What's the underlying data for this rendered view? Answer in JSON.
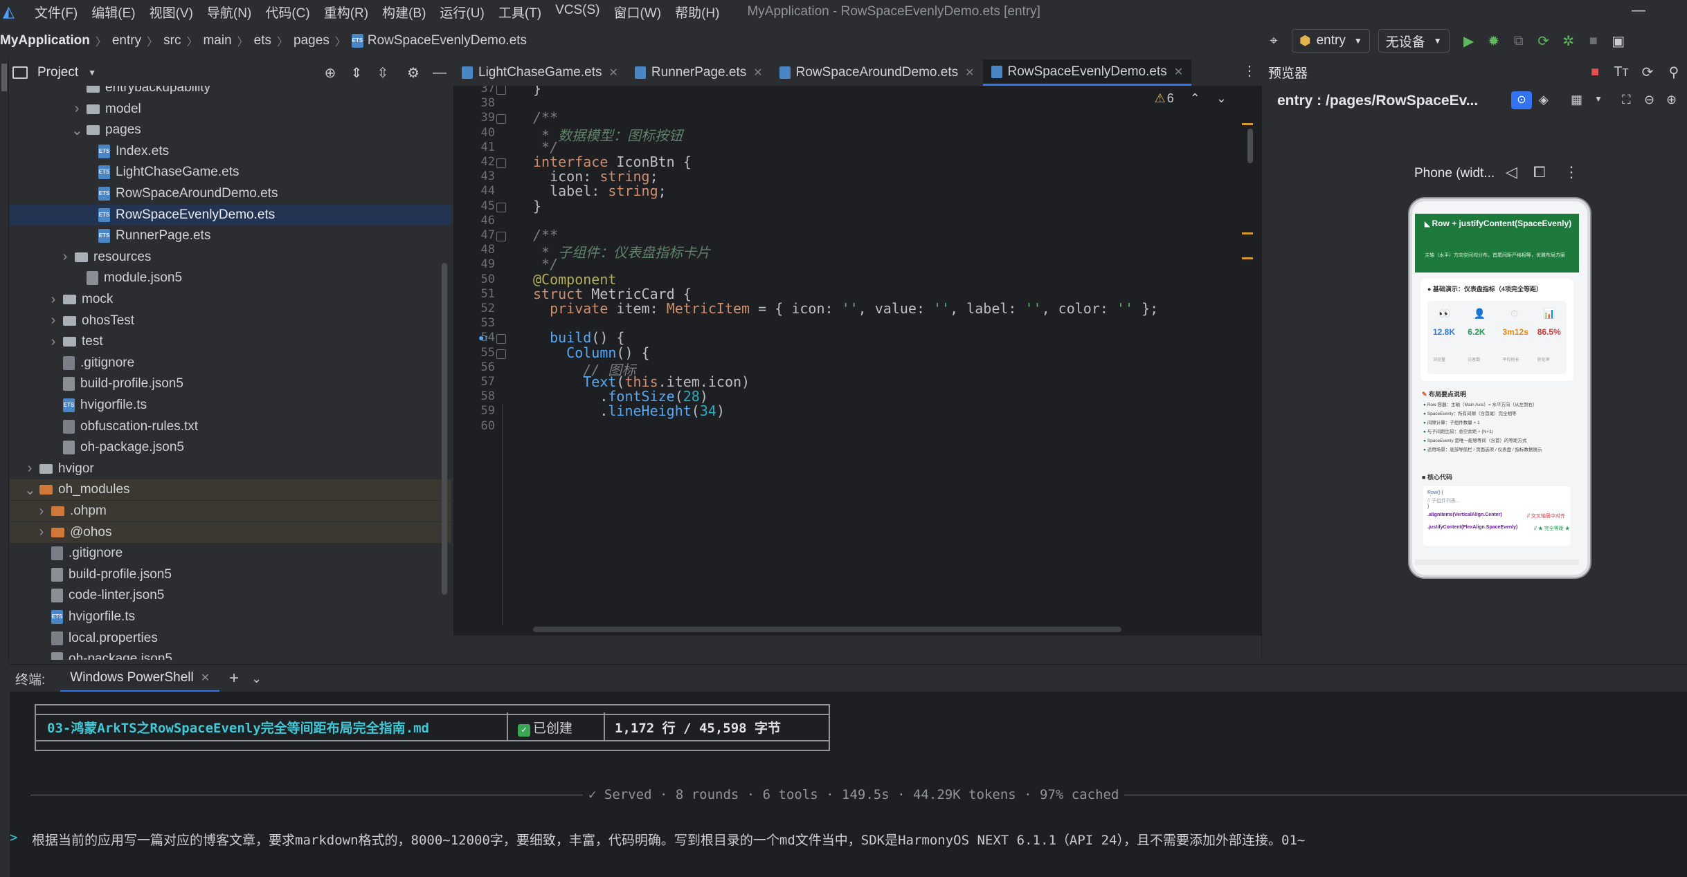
{
  "menubar": {
    "items": [
      "文件(F)",
      "编辑(E)",
      "视图(V)",
      "导航(N)",
      "代码(C)",
      "重构(R)",
      "构建(B)",
      "运行(U)",
      "工具(T)",
      "VCS(S)",
      "窗口(W)",
      "帮助(H)"
    ],
    "window_title": "MyApplication - RowSpaceEvenlyDemo.ets [entry]"
  },
  "breadcrumb": {
    "items": [
      "MyApplication",
      "entry",
      "src",
      "main",
      "ets",
      "pages",
      "RowSpaceEvenlyDemo.ets"
    ]
  },
  "toolbar": {
    "config": "entry",
    "device": "无设备"
  },
  "project": {
    "title": "Project",
    "tree": [
      {
        "label": "entrybackupability",
        "kind": "folder",
        "depth": 5,
        "chev": ""
      },
      {
        "label": "model",
        "kind": "folder",
        "depth": 5,
        "chev": "›"
      },
      {
        "label": "pages",
        "kind": "folder",
        "depth": 5,
        "chev": "⌄"
      },
      {
        "label": "Index.ets",
        "kind": "ets",
        "depth": 6,
        "chev": ""
      },
      {
        "label": "LightChaseGame.ets",
        "kind": "ets",
        "depth": 6,
        "chev": ""
      },
      {
        "label": "RowSpaceAroundDemo.ets",
        "kind": "ets",
        "depth": 6,
        "chev": ""
      },
      {
        "label": "RowSpaceEvenlyDemo.ets",
        "kind": "ets",
        "depth": 6,
        "chev": "",
        "selected": true
      },
      {
        "label": "RunnerPage.ets",
        "kind": "ets",
        "depth": 6,
        "chev": ""
      },
      {
        "label": "resources",
        "kind": "folder",
        "depth": 4,
        "chev": "›"
      },
      {
        "label": "module.json5",
        "kind": "json",
        "depth": 5,
        "chev": ""
      },
      {
        "label": "mock",
        "kind": "folder",
        "depth": 3,
        "chev": "›"
      },
      {
        "label": "ohosTest",
        "kind": "folder",
        "depth": 3,
        "chev": "›"
      },
      {
        "label": "test",
        "kind": "folder",
        "depth": 3,
        "chev": "›"
      },
      {
        "label": ".gitignore",
        "kind": "txt",
        "depth": 3,
        "chev": ""
      },
      {
        "label": "build-profile.json5",
        "kind": "json",
        "depth": 3,
        "chev": ""
      },
      {
        "label": "hvigorfile.ts",
        "kind": "ets",
        "depth": 3,
        "chev": ""
      },
      {
        "label": "obfuscation-rules.txt",
        "kind": "txt",
        "depth": 3,
        "chev": ""
      },
      {
        "label": "oh-package.json5",
        "kind": "json",
        "depth": 3,
        "chev": ""
      },
      {
        "label": "hvigor",
        "kind": "folder",
        "depth": 1,
        "chev": "›"
      },
      {
        "label": "oh_modules",
        "kind": "folder-orange",
        "depth": 1,
        "chev": "⌄",
        "module": true
      },
      {
        "label": ".ohpm",
        "kind": "folder-orange",
        "depth": 2,
        "chev": "›",
        "module": true
      },
      {
        "label": "@ohos",
        "kind": "folder-orange",
        "depth": 2,
        "chev": "›",
        "module": true
      },
      {
        "label": ".gitignore",
        "kind": "txt",
        "depth": 2,
        "chev": ""
      },
      {
        "label": "build-profile.json5",
        "kind": "json",
        "depth": 2,
        "chev": ""
      },
      {
        "label": "code-linter.json5",
        "kind": "json",
        "depth": 2,
        "chev": ""
      },
      {
        "label": "hvigorfile.ts",
        "kind": "ets",
        "depth": 2,
        "chev": ""
      },
      {
        "label": "local.properties",
        "kind": "txt",
        "depth": 2,
        "chev": ""
      },
      {
        "label": "oh-package.json5",
        "kind": "json",
        "depth": 2,
        "chev": ""
      }
    ]
  },
  "tabs": [
    {
      "label": "LightChaseGame.ets",
      "active": false
    },
    {
      "label": "RunnerPage.ets",
      "active": false
    },
    {
      "label": "RowSpaceAroundDemo.ets",
      "active": false
    },
    {
      "label": "RowSpaceEvenlyDemo.ets",
      "active": true
    }
  ],
  "editor": {
    "warning_count": "6",
    "lines": [
      {
        "n": "37",
        "html": "}"
      },
      {
        "n": "38",
        "html": ""
      },
      {
        "n": "39",
        "html": "<span class='cm'>/**</span>"
      },
      {
        "n": "40",
        "html": "<span class='cm'> * </span><span class='cmz'>数据模型：图标按钮</span>"
      },
      {
        "n": "41",
        "html": "<span class='cm'> */</span>"
      },
      {
        "n": "42",
        "html": "<span class='kw'>interface</span> IconBtn {"
      },
      {
        "n": "43",
        "html": "  icon: <span class='ty'>string</span>;"
      },
      {
        "n": "44",
        "html": "  label: <span class='ty'>string</span>;"
      },
      {
        "n": "45",
        "html": "}"
      },
      {
        "n": "46",
        "html": ""
      },
      {
        "n": "47",
        "html": "<span class='cm'>/**</span>"
      },
      {
        "n": "48",
        "html": "<span class='cm'> * </span><span class='cmz'>子组件：仪表盘指标卡片</span>"
      },
      {
        "n": "49",
        "html": "<span class='cm'> */</span>"
      },
      {
        "n": "50",
        "html": "<span class='an'>@Component</span>"
      },
      {
        "n": "51",
        "html": "<span class='kw'>struct</span> <span class='fn' style='color:#bcbec4'>MetricCard</span> {"
      },
      {
        "n": "52",
        "html": "  <span class='kw'>private</span> item: <span class='ty'>MetricItem</span> = { icon: <span class='str'>''</span>, value: <span class='str'>''</span>, label: <span class='str'>''</span>, color: <span class='str'>''</span> };"
      },
      {
        "n": "53",
        "html": ""
      },
      {
        "n": "54",
        "html": "  <span class='fn'>build</span>() {"
      },
      {
        "n": "55",
        "html": "    <span class='fn'>Column</span>() {"
      },
      {
        "n": "56",
        "html": "      <span class='cm'>// 图标</span>"
      },
      {
        "n": "57",
        "html": "      <span class='fn'>Text</span>(<span class='kw'>this</span>.item.icon)"
      },
      {
        "n": "58",
        "html": "        .<span class='fn'>fontSize</span>(<span class='num'>28</span>)"
      },
      {
        "n": "59",
        "html": "        .<span class='fn'>lineHeight</span>(<span class='num'>34</span>)"
      },
      {
        "n": "60",
        "html": ""
      }
    ]
  },
  "preview": {
    "title": "预览器",
    "route": "entry : /pages/RowSpaceEv...",
    "device_label": "Phone (widt...",
    "phone": {
      "header_title": "Row + justifyContent(SpaceEvenly)",
      "header_sub": "主轴（水平）方向空间均分布，首尾间距严格相等，优雅布局方案",
      "section1": "● 基础演示：仪表盘指标（4项完全等距）",
      "metrics": [
        {
          "icon": "👀",
          "value": "12.8K",
          "label": "浏览量",
          "color": "#2b7bd8"
        },
        {
          "icon": "👤",
          "value": "6.2K",
          "label": "访客数",
          "color": "#1e9e53"
        },
        {
          "icon": "⏱",
          "value": "3m12s",
          "label": "平均时长",
          "color": "#e08a16"
        },
        {
          "icon": "📊",
          "value": "86.5%",
          "label": "转化率",
          "color": "#d33a3a"
        }
      ],
      "section2": "布局要点说明",
      "bullets": [
        "Row 容器：主轴（Main Axis）= 水平方向（从左到右）",
        "SpaceEvenly：所有间隙（含首尾）完全相等",
        "间隙计算：子组件数量 + 1",
        "与子间距比较：总空余距 ÷ (N+1)",
        "SpaceEvenly 是唯一能够等间（含首）的等距方式",
        "适用场景：底部导航栏 / 页面选项 / 仪表盘 / 指标数据展示"
      ],
      "section3": "核心代码",
      "code": [
        "Row() {",
        "  // 子组件列表...",
        "}",
        ".alignItems(VerticalAlign.Center)",
        ".justifyContent(FlexAlign.SpaceEvenly)"
      ],
      "code_comments": [
        "// 交叉轴居中对齐",
        "// ★ 完全等距 ★"
      ]
    }
  },
  "terminal": {
    "label": "终端:",
    "tab": "Windows PowerShell",
    "table": {
      "file": "03-鸿蒙ArkTS之RowSpaceEvenly完全等间距布局完全指南.md",
      "status": "已创建",
      "stats": "1,172 行 / 45,598 字节"
    },
    "served": "✓ Served · 8 rounds · 6 tools · 149.5s · 44.29K tokens · 97% cached",
    "prompt": "根据当前的应用写一篇对应的博客文章，要求markdown格式的，8000~12000字，要细致，丰富，代码明确。写到根目录的一个md文件当中，SDK是HarmonyOS NEXT 6.1.1（API 24），且不需要添加外部连接。01~"
  },
  "colors": {
    "accent": "#3574f0",
    "selection": "#233453",
    "phone_header": "#1e7a3c"
  }
}
